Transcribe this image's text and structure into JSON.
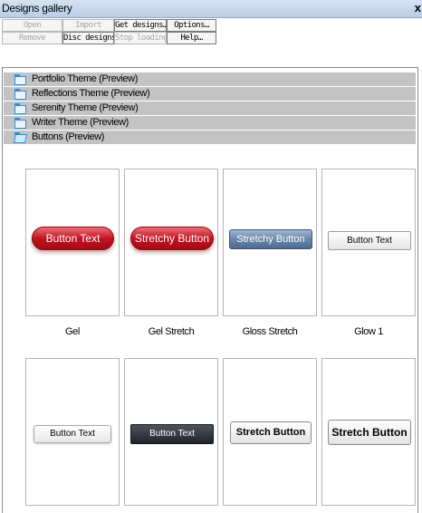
{
  "window": {
    "title": "Designs gallery",
    "close_label": "x"
  },
  "toolbar": {
    "open": "Open",
    "import": "Import",
    "get_designs": "Get designs…",
    "options": "Options…",
    "remove": "Remove",
    "disc_designs": "Disc designs…",
    "stop_loading": "Stop loading",
    "help": "Help…"
  },
  "categories": [
    {
      "label": "Portfolio Theme (Preview)",
      "expanded": false
    },
    {
      "label": "Reflections Theme (Preview)",
      "expanded": false
    },
    {
      "label": "Serenity Theme (Preview)",
      "expanded": false
    },
    {
      "label": "Writer Theme (Preview)",
      "expanded": false
    },
    {
      "label": "Buttons (Preview)",
      "expanded": true
    }
  ],
  "designs": [
    {
      "caption": "Gel",
      "sample_text": "Button Text"
    },
    {
      "caption": "Gel Stretch",
      "sample_text": "Stretchy Button"
    },
    {
      "caption": "Gloss Stretch",
      "sample_text": "Stretchy Button"
    },
    {
      "caption": "Glow 1",
      "sample_text": "Button Text"
    },
    {
      "caption": "",
      "sample_text": "Button Text"
    },
    {
      "caption": "",
      "sample_text": "Button Text"
    },
    {
      "caption": "",
      "sample_text": "Stretch Button"
    },
    {
      "caption": "",
      "sample_text": "Stretch Button"
    }
  ],
  "colors": {
    "accent_red": "#c3121f",
    "gloss_blue": "#6b88ab",
    "folder_blue": "#2a8fe0",
    "row_gray": "#c3c3c3"
  }
}
